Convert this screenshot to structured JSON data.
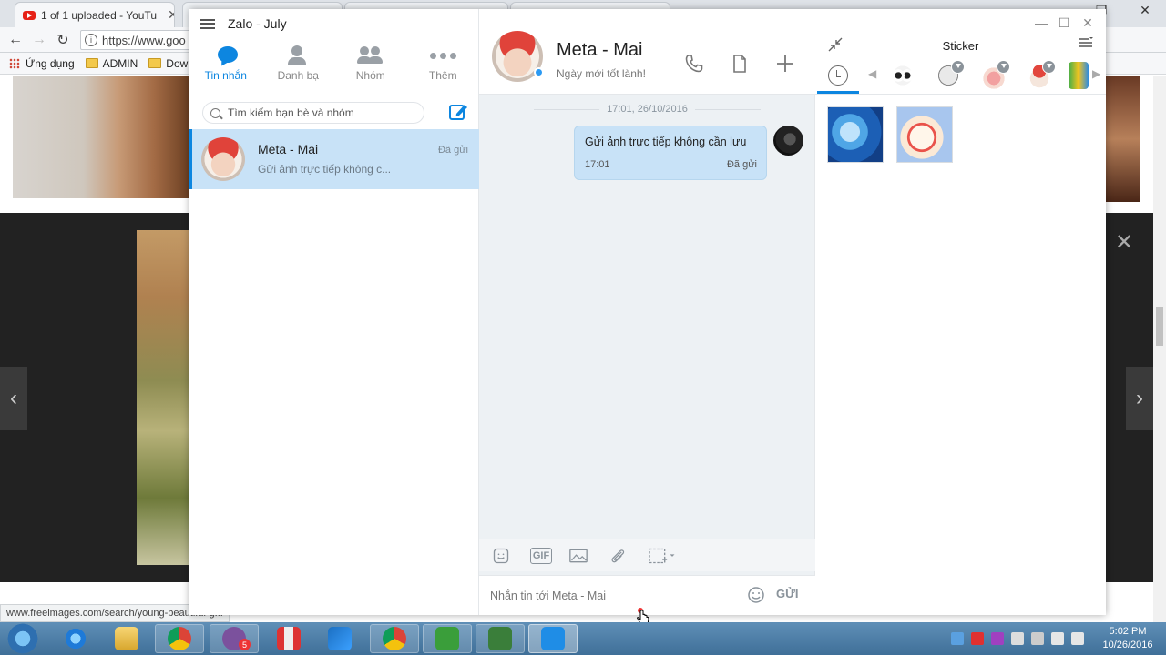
{
  "browser": {
    "tabs": [
      {
        "label": "1 of 1 uploaded - YouTu"
      },
      {
        "label": ""
      },
      {
        "label": ""
      },
      {
        "label": ""
      }
    ],
    "url": "https://www.goo",
    "bookmarks": [
      {
        "label": "Ứng dụng",
        "icon": "apps-grid-icon"
      },
      {
        "label": "ADMIN",
        "icon": "folder-icon"
      },
      {
        "label": "Down",
        "icon": "folder-icon"
      }
    ],
    "status_url": "www.freeimages.com/search/young-beautiful-g..."
  },
  "zalo": {
    "window_title": "Zalo - July",
    "nav": [
      {
        "label": "Tin nhắn",
        "icon": "chat-icon",
        "active": true
      },
      {
        "label": "Danh bạ",
        "icon": "contacts-icon",
        "active": false
      },
      {
        "label": "Nhóm",
        "icon": "group-icon",
        "active": false
      },
      {
        "label": "Thêm",
        "icon": "more-icon",
        "active": false
      }
    ],
    "search_placeholder": "Tìm kiếm bạn bè và nhóm",
    "conversations": [
      {
        "name": "Meta - Mai",
        "status": "Đã gửi",
        "preview": "Gửi ảnh trực tiếp không c..."
      }
    ],
    "chat": {
      "name": "Meta - Mai",
      "subtitle": "Ngày mới tốt lành!",
      "date_separator": "17:01, 26/10/2016",
      "messages": [
        {
          "text": "Gửi ảnh trực tiếp không cần lưu",
          "time": "17:01",
          "status": "Đã gửi"
        }
      ],
      "tools": {
        "gif_label": "GIF"
      },
      "input_placeholder": "Nhắn tin tới Meta - Mai",
      "send_label": "GỬI"
    },
    "sticker": {
      "title": "Sticker"
    }
  },
  "taskbar": {
    "time": "5:02 PM",
    "date": "10/26/2016",
    "viber_badge": "5"
  },
  "colors": {
    "accent": "#0d86e0",
    "selected_row": "#c8e2f7",
    "chat_bg": "#edf1f4"
  }
}
